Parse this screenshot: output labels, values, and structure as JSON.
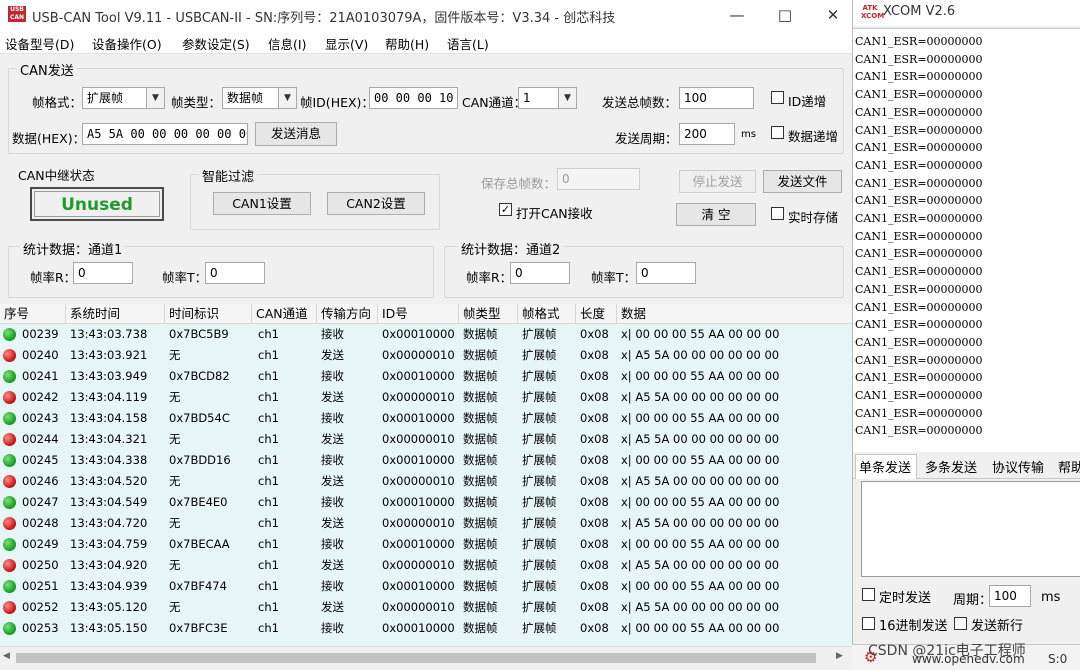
{
  "main": {
    "logo_text": "USB\nCAN",
    "title": "USB-CAN Tool V9.11 - USBCAN-II - SN:序列号：21A0103079A，固件版本号：V3.34 - 创芯科技",
    "menu": [
      "设备型号(D)",
      "设备操作(O)",
      "参数设定(S)",
      "信息(I)",
      "显示(V)",
      "帮助(H)",
      "语言(L)"
    ],
    "can_send": {
      "title": "CAN发送",
      "frame_format_label": "帧格式：",
      "frame_format_value": "扩展帧",
      "frame_type_label": "帧类型：",
      "frame_type_value": "数据帧",
      "frame_id_label": "帧ID(HEX)：",
      "frame_id_value": "00 00 00 10",
      "channel_label": "CAN通道：",
      "channel_value": "1",
      "total_frames_label": "发送总帧数：",
      "total_frames_value": "100",
      "id_increment_label": "ID递增",
      "data_label": "数据(HEX)：",
      "data_value": "A5 5A 00 00 00 00 00 00",
      "send_button": "发送消息",
      "period_label": "发送周期：",
      "period_value": "200",
      "period_unit": "ms",
      "data_increment_label": "数据递增"
    },
    "relay": {
      "title": "CAN中继状态",
      "status": "Unused"
    },
    "filter": {
      "title": "智能过滤",
      "can1_button": "CAN1设置",
      "can2_button": "CAN2设置"
    },
    "save": {
      "total_label": "保存总帧数：",
      "total_value": "0",
      "stop_button": "停止发送",
      "send_file_button": "发送文件",
      "open_can_recv_label": "打开CAN接收",
      "clear_button": "清 空",
      "realtime_save_label": "实时存储"
    },
    "stats1": {
      "title": "统计数据：通道1",
      "rate_r_label": "帧率R：",
      "rate_r_value": "0",
      "rate_t_label": "帧率T：",
      "rate_t_value": "0"
    },
    "stats2": {
      "title": "统计数据：通道2",
      "rate_r_label": "帧率R：",
      "rate_r_value": "0",
      "rate_t_label": "帧率T：",
      "rate_t_value": "0"
    },
    "columns": [
      "序号",
      "系统时间",
      "时间标识",
      "CAN通道",
      "传输方向",
      "ID号",
      "帧类型",
      "帧格式",
      "长度",
      "数据"
    ],
    "rows": [
      {
        "status": "green",
        "seq": "00239",
        "time": "13:43:03.738",
        "stamp": "0x7BC5B9",
        "ch": "ch1",
        "dir": "接收",
        "id": "0x00010000",
        "type": "数据帧",
        "fmt": "扩展帧",
        "len": "0x08",
        "data": "x| 00 00 00 55 AA 00 00 00"
      },
      {
        "status": "red",
        "seq": "00240",
        "time": "13:43:03.921",
        "stamp": "无",
        "ch": "ch1",
        "dir": "发送",
        "id": "0x00000010",
        "type": "数据帧",
        "fmt": "扩展帧",
        "len": "0x08",
        "data": "x| A5 5A 00 00 00 00 00 00"
      },
      {
        "status": "green",
        "seq": "00241",
        "time": "13:43:03.949",
        "stamp": "0x7BCD82",
        "ch": "ch1",
        "dir": "接收",
        "id": "0x00010000",
        "type": "数据帧",
        "fmt": "扩展帧",
        "len": "0x08",
        "data": "x| 00 00 00 55 AA 00 00 00"
      },
      {
        "status": "red",
        "seq": "00242",
        "time": "13:43:04.119",
        "stamp": "无",
        "ch": "ch1",
        "dir": "发送",
        "id": "0x00000010",
        "type": "数据帧",
        "fmt": "扩展帧",
        "len": "0x08",
        "data": "x| A5 5A 00 00 00 00 00 00"
      },
      {
        "status": "green",
        "seq": "00243",
        "time": "13:43:04.158",
        "stamp": "0x7BD54C",
        "ch": "ch1",
        "dir": "接收",
        "id": "0x00010000",
        "type": "数据帧",
        "fmt": "扩展帧",
        "len": "0x08",
        "data": "x| 00 00 00 55 AA 00 00 00"
      },
      {
        "status": "red",
        "seq": "00244",
        "time": "13:43:04.321",
        "stamp": "无",
        "ch": "ch1",
        "dir": "发送",
        "id": "0x00000010",
        "type": "数据帧",
        "fmt": "扩展帧",
        "len": "0x08",
        "data": "x| A5 5A 00 00 00 00 00 00"
      },
      {
        "status": "green",
        "seq": "00245",
        "time": "13:43:04.338",
        "stamp": "0x7BDD16",
        "ch": "ch1",
        "dir": "接收",
        "id": "0x00010000",
        "type": "数据帧",
        "fmt": "扩展帧",
        "len": "0x08",
        "data": "x| 00 00 00 55 AA 00 00 00"
      },
      {
        "status": "red",
        "seq": "00246",
        "time": "13:43:04.520",
        "stamp": "无",
        "ch": "ch1",
        "dir": "发送",
        "id": "0x00000010",
        "type": "数据帧",
        "fmt": "扩展帧",
        "len": "0x08",
        "data": "x| A5 5A 00 00 00 00 00 00"
      },
      {
        "status": "green",
        "seq": "00247",
        "time": "13:43:04.549",
        "stamp": "0x7BE4E0",
        "ch": "ch1",
        "dir": "接收",
        "id": "0x00010000",
        "type": "数据帧",
        "fmt": "扩展帧",
        "len": "0x08",
        "data": "x| 00 00 00 55 AA 00 00 00"
      },
      {
        "status": "red",
        "seq": "00248",
        "time": "13:43:04.720",
        "stamp": "无",
        "ch": "ch1",
        "dir": "发送",
        "id": "0x00000010",
        "type": "数据帧",
        "fmt": "扩展帧",
        "len": "0x08",
        "data": "x| A5 5A 00 00 00 00 00 00"
      },
      {
        "status": "green",
        "seq": "00249",
        "time": "13:43:04.759",
        "stamp": "0x7BECAA",
        "ch": "ch1",
        "dir": "接收",
        "id": "0x00010000",
        "type": "数据帧",
        "fmt": "扩展帧",
        "len": "0x08",
        "data": "x| 00 00 00 55 AA 00 00 00"
      },
      {
        "status": "red",
        "seq": "00250",
        "time": "13:43:04.920",
        "stamp": "无",
        "ch": "ch1",
        "dir": "发送",
        "id": "0x00000010",
        "type": "数据帧",
        "fmt": "扩展帧",
        "len": "0x08",
        "data": "x| A5 5A 00 00 00 00 00 00"
      },
      {
        "status": "green",
        "seq": "00251",
        "time": "13:43:04.939",
        "stamp": "0x7BF474",
        "ch": "ch1",
        "dir": "接收",
        "id": "0x00010000",
        "type": "数据帧",
        "fmt": "扩展帧",
        "len": "0x08",
        "data": "x| 00 00 00 55 AA 00 00 00"
      },
      {
        "status": "red",
        "seq": "00252",
        "time": "13:43:05.120",
        "stamp": "无",
        "ch": "ch1",
        "dir": "发送",
        "id": "0x00000010",
        "type": "数据帧",
        "fmt": "扩展帧",
        "len": "0x08",
        "data": "x| A5 5A 00 00 00 00 00 00"
      },
      {
        "status": "green",
        "seq": "00253",
        "time": "13:43:05.150",
        "stamp": "0x7BFC3E",
        "ch": "ch1",
        "dir": "接收",
        "id": "0x00010000",
        "type": "数据帧",
        "fmt": "扩展帧",
        "len": "0x08",
        "data": "x| 00 00 00 55 AA 00 00 00"
      }
    ]
  },
  "xcom": {
    "logo_text": "ATK\nXCOM",
    "title": "XCOM V2.6",
    "log_lines": [
      "CAN1_ESR=00000000",
      "CAN1_ESR=00000000",
      "CAN1_ESR=00000000",
      "CAN1_ESR=00000000",
      "CAN1_ESR=00000000",
      "CAN1_ESR=00000000",
      "CAN1_ESR=00000000",
      "CAN1_ESR=00000000",
      "CAN1_ESR=00000000",
      "CAN1_ESR=00000000",
      "CAN1_ESR=00000000",
      "CAN1_ESR=00000000",
      "CAN1_ESR=00000000",
      "CAN1_ESR=00000000",
      "CAN1_ESR=00000000",
      "CAN1_ESR=00000000",
      "CAN1_ESR=00000000",
      "CAN1_ESR=00000000",
      "CAN1_ESR=00000000",
      "CAN1_ESR=00000000",
      "CAN1_ESR=00000000",
      "CAN1_ESR=00000000",
      "CAN1_ESR=00000000"
    ],
    "tabs": [
      "单条发送",
      "多条发送",
      "协议传输",
      "帮助"
    ],
    "timed_send_label": "定时发送",
    "period_label": "周期：",
    "period_value": "100",
    "period_unit": "ms",
    "hex_send_label": "16进制发送",
    "newline_label": "发送新行",
    "footer_url": "www.openedv.com",
    "footer_status": "S:0",
    "watermark": "CSDN @21ic电子工程师"
  }
}
